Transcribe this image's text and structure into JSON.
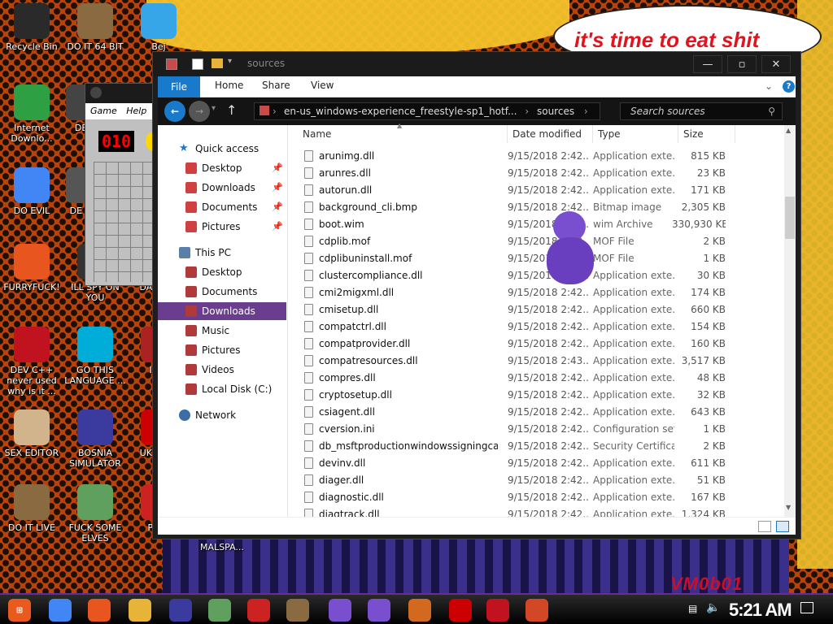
{
  "window": {
    "title": "sources",
    "ribbon_tabs": [
      "File",
      "Home",
      "Share",
      "View"
    ],
    "breadcrumb": [
      "en-us_windows-experience_freestyle-sp1_hotf...",
      "sources"
    ],
    "search_placeholder": "Search sources"
  },
  "banner_text": "it's time to eat shit",
  "watermark": "VM0b01",
  "clock": "5:21 AM",
  "desktop_icons": [
    {
      "label": "Recycle Bin",
      "color": "#2a2a2a"
    },
    {
      "label": "DO IT 64 BIT",
      "color": "#8a6a40"
    },
    {
      "label": "Bej",
      "color": "#37a6e8"
    },
    {
      "label": "Internet Downlo...",
      "color": "#2ea043"
    },
    {
      "label": "DET",
      "color": "#444444"
    },
    {
      "label": "DO EVIL",
      "color": "#4285f4"
    },
    {
      "label": "DE HA",
      "color": "#555555"
    },
    {
      "label": "FURRYFUCK!",
      "color": "#e8551e"
    },
    {
      "label": "ILL SPY ON YOU",
      "color": "#333333"
    },
    {
      "label": "DA SIMU",
      "color": "#884422"
    },
    {
      "label": "DEV C++ never used why is it ...",
      "color": "#c1121f"
    },
    {
      "label": "GO THIS LANGUAGE ...",
      "color": "#00add8"
    },
    {
      "label": "I CH",
      "color": "#aa2222"
    },
    {
      "label": "SEX EDITOR",
      "color": "#d2b48c"
    },
    {
      "label": "BOSNIA SIMULATOR",
      "color": "#3b3b9f"
    },
    {
      "label": "UK SIMU",
      "color": "#cc0000"
    },
    {
      "label": "DO IT LIVE",
      "color": "#8a6a40"
    },
    {
      "label": "FUCK SOME ELVES",
      "color": "#5fa05f"
    },
    {
      "label": "Pegg",
      "color": "#cc2222"
    },
    {
      "label": "MALSPA...",
      "color": "#333333"
    }
  ],
  "nav": {
    "quick_access": "Quick access",
    "quick_items": [
      "Desktop",
      "Downloads",
      "Documents",
      "Pictures"
    ],
    "this_pc": "This PC",
    "pc_items": [
      "Desktop",
      "Documents",
      "Downloads",
      "Music",
      "Pictures",
      "Videos",
      "Local Disk (C:)"
    ],
    "network": "Network"
  },
  "columns": [
    "Name",
    "Date modified",
    "Type",
    "Size"
  ],
  "files": [
    {
      "name": "arunimg.dll",
      "date": "9/15/2018 2:42...",
      "type": "Application exte...",
      "size": "815 KB"
    },
    {
      "name": "arunres.dll",
      "date": "9/15/2018 2:42...",
      "type": "Application exte...",
      "size": "23 KB"
    },
    {
      "name": "autorun.dll",
      "date": "9/15/2018 2:42...",
      "type": "Application exte...",
      "size": "171 KB"
    },
    {
      "name": "background_cli.bmp",
      "date": "9/15/2018 2:42...",
      "type": "Bitmap image",
      "size": "2,305 KB"
    },
    {
      "name": "boot.wim",
      "date": "9/15/2018 2:42...",
      "type": "wim Archive",
      "size": "330,930 KB"
    },
    {
      "name": "cdplib.mof",
      "date": "9/15/2018 2:42...",
      "type": "MOF File",
      "size": "2 KB"
    },
    {
      "name": "cdplibuninstall.mof",
      "date": "9/15/2018 2:42...",
      "type": "MOF File",
      "size": "1 KB"
    },
    {
      "name": "clustercompliance.dll",
      "date": "9/15/2018 2:42...",
      "type": "Application exte...",
      "size": "30 KB"
    },
    {
      "name": "cmi2migxml.dll",
      "date": "9/15/2018 2:42...",
      "type": "Application exte...",
      "size": "174 KB"
    },
    {
      "name": "cmisetup.dll",
      "date": "9/15/2018 2:42...",
      "type": "Application exte...",
      "size": "660 KB"
    },
    {
      "name": "compatctrl.dll",
      "date": "9/15/2018 2:42...",
      "type": "Application exte...",
      "size": "154 KB"
    },
    {
      "name": "compatprovider.dll",
      "date": "9/15/2018 2:42...",
      "type": "Application exte...",
      "size": "160 KB"
    },
    {
      "name": "compatresources.dll",
      "date": "9/15/2018 2:43...",
      "type": "Application exte...",
      "size": "3,517 KB"
    },
    {
      "name": "compres.dll",
      "date": "9/15/2018 2:42...",
      "type": "Application exte...",
      "size": "48 KB"
    },
    {
      "name": "cryptosetup.dll",
      "date": "9/15/2018 2:42...",
      "type": "Application exte...",
      "size": "32 KB"
    },
    {
      "name": "csiagent.dll",
      "date": "9/15/2018 2:42...",
      "type": "Application exte...",
      "size": "643 KB"
    },
    {
      "name": "cversion.ini",
      "date": "9/15/2018 2:42...",
      "type": "Configuration set...",
      "size": "1 KB"
    },
    {
      "name": "db_msftproductionwindowssigningca.cer",
      "date": "9/15/2018 2:42...",
      "type": "Security Certificate",
      "size": "2 KB"
    },
    {
      "name": "devinv.dll",
      "date": "9/15/2018 2:42...",
      "type": "Application exte...",
      "size": "611 KB"
    },
    {
      "name": "diager.dll",
      "date": "9/15/2018 2:42...",
      "type": "Application exte...",
      "size": "51 KB"
    },
    {
      "name": "diagnostic.dll",
      "date": "9/15/2018 2:42...",
      "type": "Application exte...",
      "size": "167 KB"
    },
    {
      "name": "diagtrack.dll",
      "date": "9/15/2018 2:42...",
      "type": "Application exte...",
      "size": "1,324 KB"
    }
  ],
  "minesweeper": {
    "menu": [
      "Game",
      "Help"
    ],
    "counter": "010"
  },
  "taskbar_apps": [
    {
      "name": "chrome-icon",
      "color": "#4285f4"
    },
    {
      "name": "firefox-icon",
      "color": "#e8551e"
    },
    {
      "name": "folder-icon",
      "color": "#e8b339"
    },
    {
      "name": "bosnia-icon",
      "color": "#3b3b9f"
    },
    {
      "name": "elf-icon",
      "color": "#5fa05f"
    },
    {
      "name": "pegg-icon",
      "color": "#cc2222"
    },
    {
      "name": "lady-icon",
      "color": "#8a6a40"
    },
    {
      "name": "bonzi-icon",
      "color": "#7a4fcf"
    },
    {
      "name": "bonzi2-icon",
      "color": "#7a4fcf"
    },
    {
      "name": "app-icon",
      "color": "#d2691e"
    },
    {
      "name": "radiation-icon",
      "color": "#cc0000"
    },
    {
      "name": "devcpp-icon",
      "color": "#c1121f"
    },
    {
      "name": "powerpoint-icon",
      "color": "#d24726"
    }
  ]
}
